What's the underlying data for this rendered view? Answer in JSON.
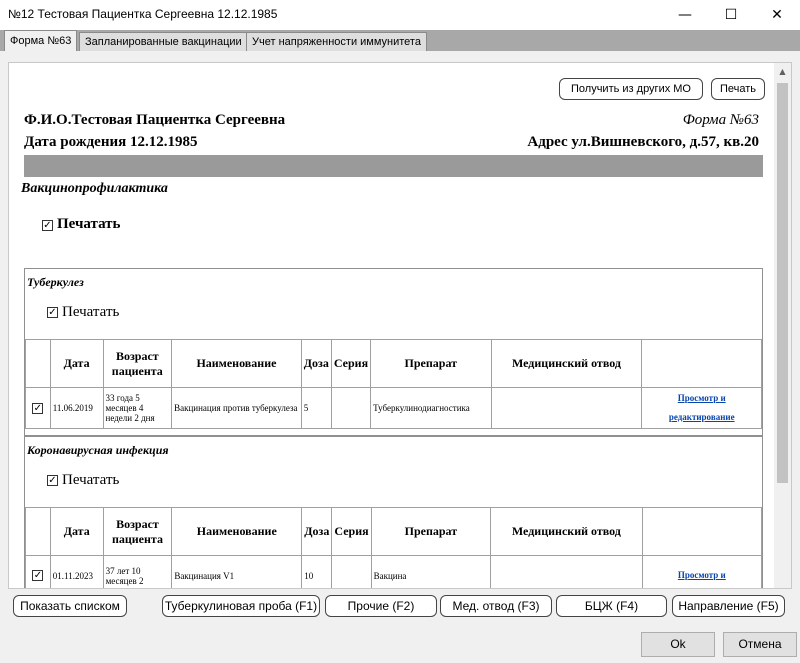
{
  "window": {
    "title": "№12 Тестовая Пациентка Сергеевна 12.12.1985",
    "minimize_glyph": "—",
    "maximize_glyph": "☐",
    "close_glyph": "✕"
  },
  "tabs": [
    {
      "label": "Форма №63",
      "active": true
    },
    {
      "label": "Запланированные вакцинации",
      "active": false
    },
    {
      "label": "Учет напряженности иммунитета",
      "active": false
    }
  ],
  "toolbar": {
    "get_from_mo_label": "Получить из других МО",
    "print_label": "Печать"
  },
  "patient": {
    "fio": "Ф.И.О.Тестовая Пациентка Сергеевна",
    "form_name": "Форма №63",
    "birth_date": "Дата рождения 12.12.1985",
    "address": "Адрес ул.Вишневского, д.57, кв.20"
  },
  "main": {
    "section_heading": "Вакцинопрофилактика",
    "print_label": "Печатать",
    "print_checked": true
  },
  "columns": [
    "Дата",
    "Возраст пациента",
    "Наименование",
    "Доза",
    "Серия",
    "Препарат",
    "Медицинский отвод"
  ],
  "sections": [
    {
      "title": "Туберкулез",
      "print_label": "Печатать",
      "rows": [
        {
          "checked": true,
          "date": "11.06.2019",
          "age": "33 года 5 месяцев 4 недели 2 дня",
          "name": "Вакцинация против туберкулеза",
          "dose": "5",
          "series": "",
          "drug": "Туберкулинодиагностика",
          "exemption": "",
          "link": "Просмотр и редактирование"
        }
      ]
    },
    {
      "title": "Коронавирусная инфекция",
      "print_label": "Печатать",
      "rows": [
        {
          "checked": true,
          "date": "01.11.2023",
          "age": "37 лет 10 месяцев 2",
          "name": "Вакцинация V1",
          "dose": "10",
          "series": "",
          "drug": "Вакцина",
          "exemption": "",
          "link": "Просмотр и"
        }
      ]
    }
  ],
  "bottom_buttons": {
    "show_list": "Показать списком",
    "tuberculin": "Туберкулиновая проба (F1)",
    "other": "Прочие (F2)",
    "med_exemption": "Мед. отвод (F3)",
    "bcg": "БЦЖ (F4)",
    "referral": "Направление (F5)"
  },
  "footer": {
    "ok": "Ok",
    "cancel": "Отмена"
  }
}
